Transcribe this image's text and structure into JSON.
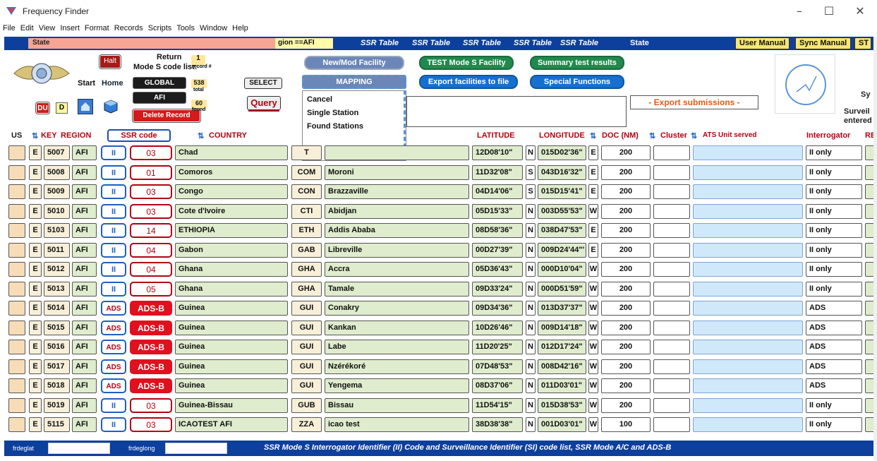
{
  "window": {
    "title": "Frequency Finder",
    "minimize": "–",
    "maximize": "☐",
    "close": "✕"
  },
  "menu": [
    "File",
    "Edit",
    "View",
    "Insert",
    "Format",
    "Records",
    "Scripts",
    "Tools",
    "Window",
    "Help"
  ],
  "ribbon": {
    "state_label": "State",
    "region_prefix": "gion",
    "region_value": "==AFI",
    "ssr_links": [
      "SSR Table",
      "SSR Table",
      "SSR Table",
      "SSR Table",
      "SSR Table"
    ],
    "state_right": "State",
    "user_manual": "User Manual",
    "sync_manual": "Sync Manual",
    "st": "ST"
  },
  "header": {
    "halt": "Halt",
    "return_label": "Return",
    "mode_s_label": "Mode S code list:",
    "start": "Start",
    "home": "Home",
    "global": "GLOBAL",
    "afi": "AFI",
    "delete_record": "Delete Record",
    "du": "DU",
    "d": "D",
    "record_num": "1",
    "record_label": "record #",
    "total_num": "538",
    "total_label": "total",
    "found_num": "60",
    "found_label": "found",
    "select": "SELECT",
    "query": "Query",
    "new_mod_facility": "New/Mod Facility",
    "test_mode_s": "TEST Mode S Facility",
    "summary_test": "Summary test results",
    "mapping": "MAPPING",
    "export_facilities": "Export facilities to file",
    "special_functions": "Special Functions",
    "export_submissions": "- Export submissions -",
    "right_sy": "Sy",
    "right_surveil": "Surveil",
    "right_entered": "entered",
    "dropdown": [
      "Cancel",
      "Single Station",
      "Found Stations"
    ]
  },
  "columns": {
    "us": "US",
    "key": "KEY",
    "region": "REGION",
    "ssr_code": "SSR code",
    "country": "COUNTRY",
    "latitude": "LATITUDE",
    "longitude": "LONGITUDE",
    "doc": "DOC (NM)",
    "cluster": "Cluster",
    "ats_unit": "ATS Unit served",
    "interrogator": "Interrogator",
    "re": "RE"
  },
  "rows": [
    {
      "e": "E",
      "key": "5007",
      "region": "AFI",
      "type": "II",
      "code": "03",
      "country": "Chad",
      "cc": "T",
      "city": "",
      "lat": "12D08'10\"",
      "ns": "N",
      "lon": "015D02'36\"",
      "ew": "E",
      "doc": "200",
      "interrogator": "II only"
    },
    {
      "e": "E",
      "key": "5008",
      "region": "AFI",
      "type": "II",
      "code": "01",
      "country": "Comoros",
      "cc": "COM",
      "city": "Moroni",
      "lat": "11D32'08\"",
      "ns": "S",
      "lon": "043D16'32\"",
      "ew": "E",
      "doc": "200",
      "interrogator": "II only"
    },
    {
      "e": "E",
      "key": "5009",
      "region": "AFI",
      "type": "II",
      "code": "03",
      "country": "Congo",
      "cc": "CON",
      "city": "Brazzaville",
      "lat": "04D14'06\"",
      "ns": "S",
      "lon": "015D15'41\"",
      "ew": "E",
      "doc": "200",
      "interrogator": "II only"
    },
    {
      "e": "E",
      "key": "5010",
      "region": "AFI",
      "type": "II",
      "code": "03",
      "country": "Cote d'Ivoire",
      "cc": "CTI",
      "city": "Abidjan",
      "lat": "05D15'33\"",
      "ns": "N",
      "lon": "003D55'53\"",
      "ew": "W",
      "doc": "200",
      "interrogator": "II only"
    },
    {
      "e": "E",
      "key": "5103",
      "region": "AFI",
      "type": "II",
      "code": "14",
      "country": "ETHIOPIA",
      "cc": "ETH",
      "city": "Addis Ababa",
      "lat": "08D58'36\"",
      "ns": "N",
      "lon": "038D47'53\"",
      "ew": "E",
      "doc": "200",
      "interrogator": "II only"
    },
    {
      "e": "E",
      "key": "5011",
      "region": "AFI",
      "type": "II",
      "code": "04",
      "country": "Gabon",
      "cc": "GAB",
      "city": "Libreville",
      "lat": "00D27'39\"",
      "ns": "N",
      "lon": "009D24'44\"'",
      "ew": "E",
      "doc": "200",
      "interrogator": "II only"
    },
    {
      "e": "E",
      "key": "5012",
      "region": "AFI",
      "type": "II",
      "code": "04",
      "country": "Ghana",
      "cc": "GHA",
      "city": "Accra",
      "lat": "05D36'43\"",
      "ns": "N",
      "lon": "000D10'04\"",
      "ew": "W",
      "doc": "200",
      "interrogator": "II only"
    },
    {
      "e": "E",
      "key": "5013",
      "region": "AFI",
      "type": "II",
      "code": "05",
      "country": "Ghana",
      "cc": "GHA",
      "city": "Tamale",
      "lat": "09D33'24\"",
      "ns": "N",
      "lon": "000D51'59\"",
      "ew": "W",
      "doc": "200",
      "interrogator": "II only"
    },
    {
      "e": "E",
      "key": "5014",
      "region": "AFI",
      "type": "ADS",
      "code": "ADS-B",
      "country": "Guinea",
      "cc": "GUI",
      "city": "Conakry",
      "lat": "09D34'36\"",
      "ns": "N",
      "lon": "013D37'37\"",
      "ew": "W",
      "doc": "200",
      "interrogator": "ADS"
    },
    {
      "e": "E",
      "key": "5015",
      "region": "AFI",
      "type": "ADS",
      "code": "ADS-B",
      "country": "Guinea",
      "cc": "GUI",
      "city": "Kankan",
      "lat": "10D26'46\"",
      "ns": "N",
      "lon": "009D14'18\"",
      "ew": "W",
      "doc": "200",
      "interrogator": "ADS"
    },
    {
      "e": "E",
      "key": "5016",
      "region": "AFI",
      "type": "ADS",
      "code": "ADS-B",
      "country": "Guinea",
      "cc": "GUI",
      "city": "Labe",
      "lat": "11D20'25\"",
      "ns": "N",
      "lon": "012D17'24\"",
      "ew": "W",
      "doc": "200",
      "interrogator": "ADS"
    },
    {
      "e": "E",
      "key": "5017",
      "region": "AFI",
      "type": "ADS",
      "code": "ADS-B",
      "country": "Guinea",
      "cc": "GUI",
      "city": "Nzérékoré",
      "lat": "07D48'53\"",
      "ns": "N",
      "lon": "008D42'16\"",
      "ew": "W",
      "doc": "200",
      "interrogator": "ADS"
    },
    {
      "e": "E",
      "key": "5018",
      "region": "AFI",
      "type": "ADS",
      "code": "ADS-B",
      "country": "Guinea",
      "cc": "GUI",
      "city": "Yengema",
      "lat": "08D37'06\"",
      "ns": "N",
      "lon": "011D03'01\"",
      "ew": "W",
      "doc": "200",
      "interrogator": "ADS"
    },
    {
      "e": "E",
      "key": "5019",
      "region": "AFI",
      "type": "II",
      "code": "03",
      "country": "Guinea-Bissau",
      "cc": "GUB",
      "city": "Bissau",
      "lat": "11D54'15\"",
      "ns": "N",
      "lon": "015D38'53\"",
      "ew": "W",
      "doc": "200",
      "interrogator": "II only"
    },
    {
      "e": "E",
      "key": "5115",
      "region": "AFI",
      "type": "II",
      "code": "03",
      "country": "ICAOTEST AFI",
      "cc": "ZZA",
      "city": "icao test",
      "lat": "38D38'38\"",
      "ns": "N",
      "lon": "001D03'01\"",
      "ew": "W",
      "doc": "100",
      "interrogator": "II only"
    }
  ],
  "footer": {
    "frdeglat": "frdeglat",
    "frdeglong": "frdeglong",
    "text": "SSR Mode S Interrogator Identifier (II) Code and Surveillance Identifier (SI) code list, SSR Mode A/C and ADS-B"
  }
}
